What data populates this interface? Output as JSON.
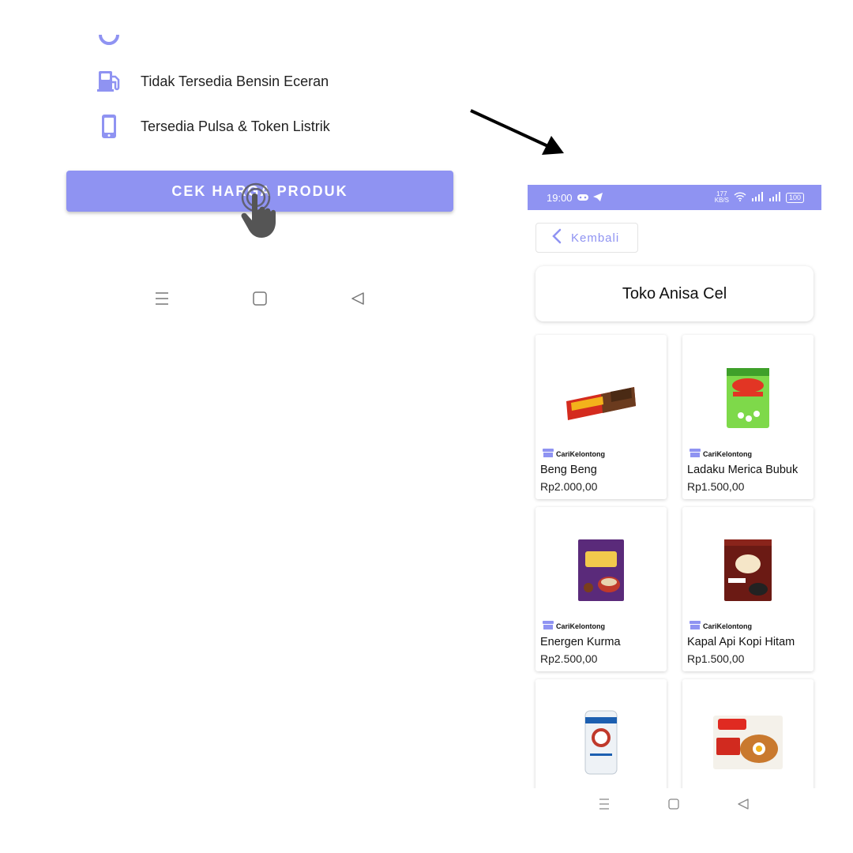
{
  "left_screen": {
    "info_rows": [
      {
        "icon": "fuel-pump-icon",
        "label": "Tidak Tersedia Bensin Eceran"
      },
      {
        "icon": "phone-icon",
        "label": "Tersedia Pulsa & Token Listrik"
      }
    ],
    "cek_button_label": "CEK HARGA PRODUK",
    "nav": [
      "menu-icon",
      "home-icon",
      "back-icon"
    ]
  },
  "right_screen": {
    "status_bar": {
      "time": "19:00",
      "speed_value": "177",
      "speed_unit": "KB/S",
      "battery": "100"
    },
    "back_label": "Kembali",
    "store_name": "Toko Anisa Cel",
    "brand_label": "CariKelontong",
    "products": [
      {
        "name": "Beng Beng",
        "price": "Rp2.000,00"
      },
      {
        "name": "Ladaku Merica Bubuk",
        "price": "Rp1.500,00"
      },
      {
        "name": "Energen Kurma",
        "price": "Rp2.500,00"
      },
      {
        "name": "Kapal Api Kopi Hitam",
        "price": "Rp1.500,00"
      },
      {
        "name": "",
        "price": ""
      },
      {
        "name": "",
        "price": ""
      }
    ],
    "nav": [
      "menu-icon",
      "home-icon",
      "back-icon"
    ]
  },
  "colors": {
    "accent": "#8f93f2",
    "icon_purple": "#8f93f2"
  }
}
